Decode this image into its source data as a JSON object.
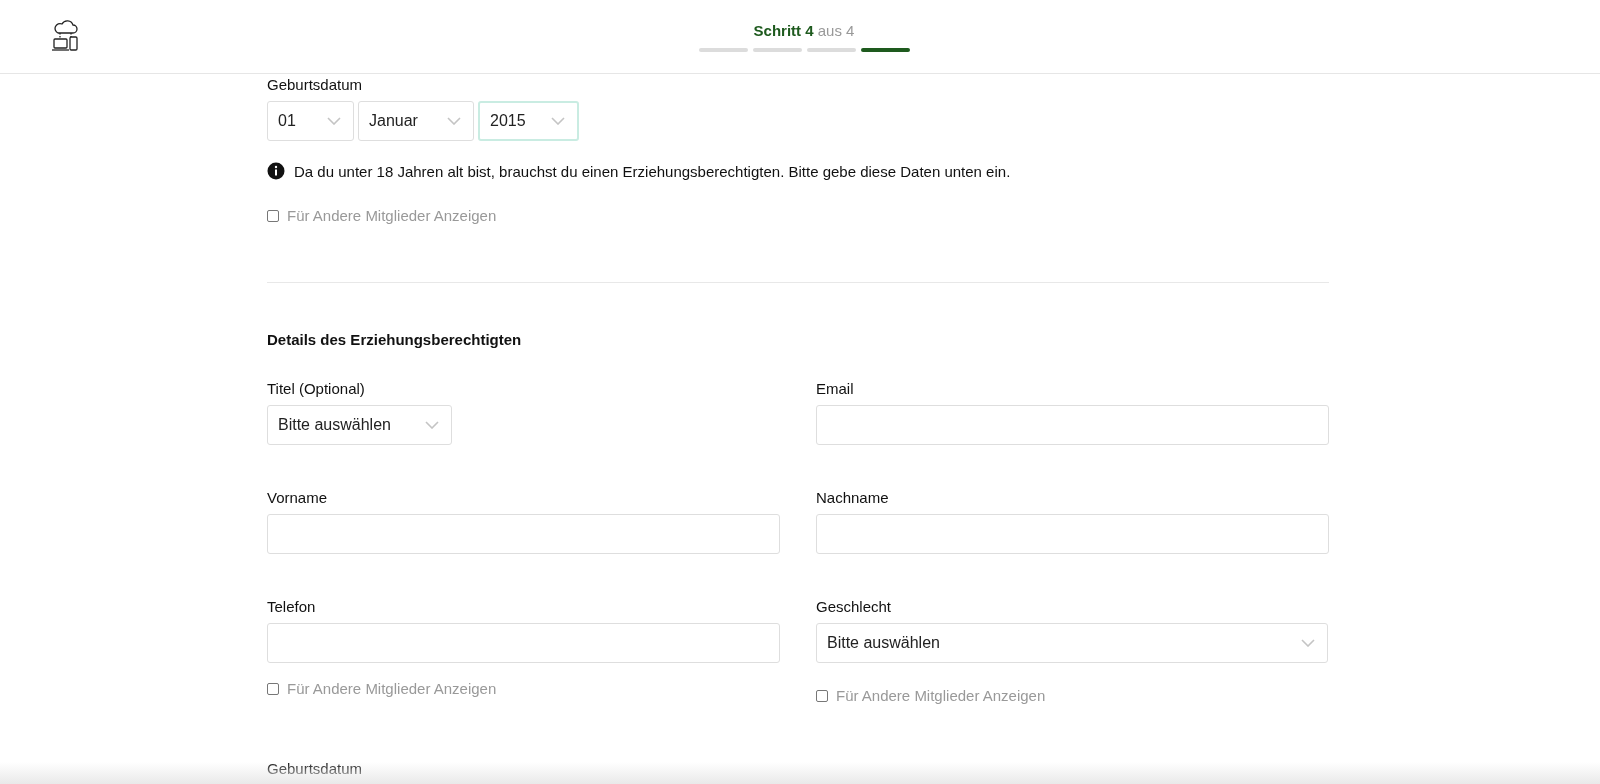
{
  "header": {
    "step_label": "Schritt 4",
    "step_suffix": "aus 4",
    "steps": [
      {
        "selected": false
      },
      {
        "selected": false
      },
      {
        "selected": false
      },
      {
        "selected": true
      }
    ]
  },
  "birthdate": {
    "label": "Geburtsdatum",
    "selects": [
      {
        "value": "01",
        "focused": false
      },
      {
        "value": "Januar",
        "focused": false
      },
      {
        "value": "2015",
        "focused": true
      }
    ]
  },
  "info": "Da du unter 18 Jahren alt bist, brauchst du einen Erziehungsberechtigten. Bitte gebe diese Daten unten ein.",
  "show_to_members": {
    "label": "Für Andere Mitglieder Anzeigen",
    "checked": false
  },
  "guardian": {
    "heading": "Details des Erziehungsberechtigten",
    "rows": [
      [
        {
          "label": "Titel (Optional)",
          "kind": "select",
          "value": "Bitte auswählen"
        },
        {
          "label": "Email",
          "kind": "input"
        }
      ],
      [
        {
          "label": "Vorname",
          "kind": "input"
        },
        {
          "label": "Nachname",
          "kind": "input"
        }
      ],
      [
        {
          "label": "Telefon",
          "kind": "input",
          "checkbox": {
            "label": "Für Andere Mitglieder Anzeigen",
            "checked": false
          }
        },
        {
          "label": "Geschlecht",
          "kind": "select",
          "value": "Bitte auswählen",
          "checkbox": {
            "label": "Für Andere Mitglieder Anzeigen",
            "checked": false
          }
        }
      ]
    ],
    "next_label": "Geburtsdatum"
  }
}
